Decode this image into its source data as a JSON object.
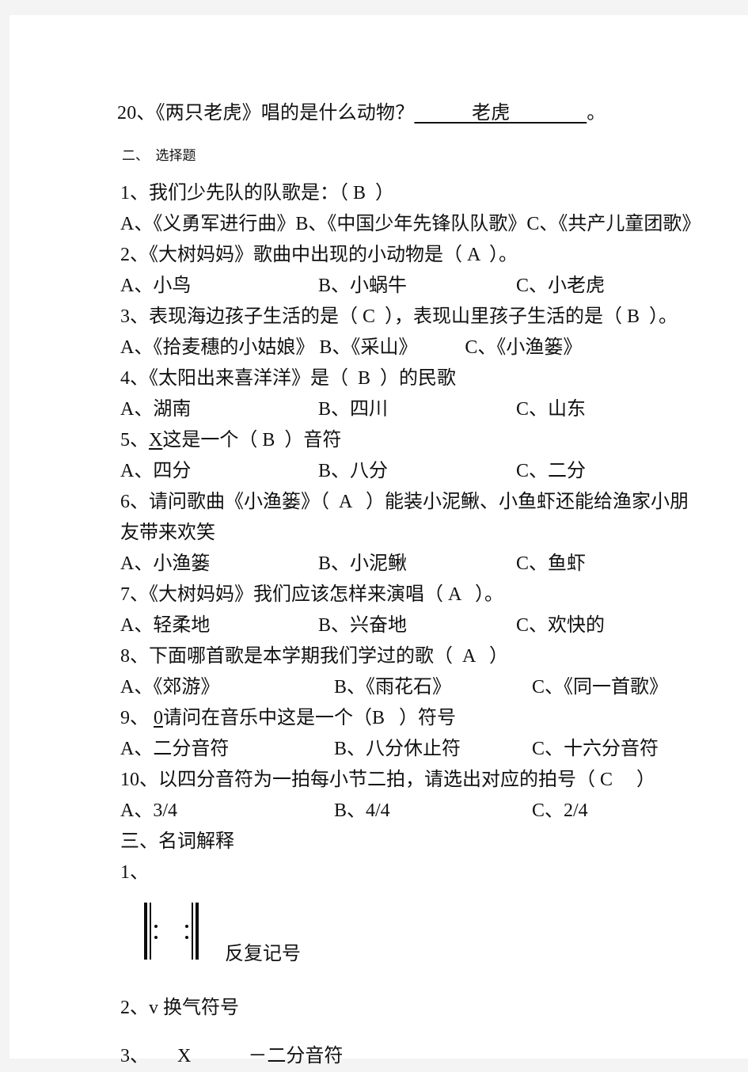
{
  "fill_in": {
    "number": "20、",
    "question": "《两只老虎》唱的是什么动物？",
    "lead_blank": "　　　",
    "answer": "老虎",
    "trail_blank": "　　　　",
    "period": "。"
  },
  "section2": {
    "heading_number": "二、",
    "heading_title": "选择题",
    "questions": [
      {
        "stem": "1、我们少先队的队歌是：（ B  ）",
        "inline_options": "A、《义勇军进行曲》B、《中国少年先锋队队歌》C、《共产儿童团歌》"
      },
      {
        "stem": "2、《大树妈妈》歌曲中出现的小动物是（ A  ）。",
        "options": [
          "A、小鸟",
          "B、小蜗牛",
          "C、小老虎"
        ]
      },
      {
        "stem": "3、表现海边孩子生活的是（ C  ），表现山里孩子生活的是（ B  ）。A、《拾麦穗的小姑娘》 B、《采山》　　　C、《小渔篓》"
      },
      {
        "stem": "4、《太阳出来喜洋洋》是（  B  ）的民歌",
        "options": [
          "A、湖南",
          "B、四川",
          "C、山东"
        ]
      },
      {
        "stem_prefix": "5、",
        "stem_symbol": "X",
        "stem_suffix": "这是一个（ B  ）音符",
        "options": [
          "A、四分",
          "B、八分",
          "C、二分"
        ]
      },
      {
        "stem": "6、请问歌曲《小渔篓》（  A   ）能装小泥鳅、小鱼虾还能给渔家小朋友带来欢笑",
        "options": [
          "A、小渔篓",
          "B、小泥鳅",
          "C、鱼虾"
        ]
      },
      {
        "stem": "7、《大树妈妈》我们应该怎样来演唱（ A   ）。",
        "options": [
          "A、轻柔地",
          "B、兴奋地",
          "C、欢快的"
        ]
      },
      {
        "stem": "8、下面哪首歌是本学期我们学过的歌（  A   ）",
        "options": [
          "A、《郊游》",
          "B、《雨花石》",
          "C、《同一首歌》"
        ]
      },
      {
        "stem_prefix": "9、 ",
        "stem_symbol": "0",
        "stem_suffix": "请问在音乐中这是一个（B   ）符号",
        "options": [
          "A、二分音符",
          "B、八分休止符",
          "C、十六分音符"
        ]
      },
      {
        "stem": "10、以四分音符为一拍每小节二拍，请选出对应的拍号（ C　 ）",
        "options": [
          "A、3/4",
          "B、4/4",
          "C、2/4"
        ]
      }
    ]
  },
  "section3": {
    "heading": "三、名词解释",
    "items": [
      {
        "number": "1、",
        "symbol_name": "repeat-sign",
        "label": "反复记号"
      },
      {
        "number": "2、",
        "text": "v 换气符号"
      },
      {
        "number": "3、",
        "text": "　　X　　　－二分音符"
      }
    ]
  }
}
